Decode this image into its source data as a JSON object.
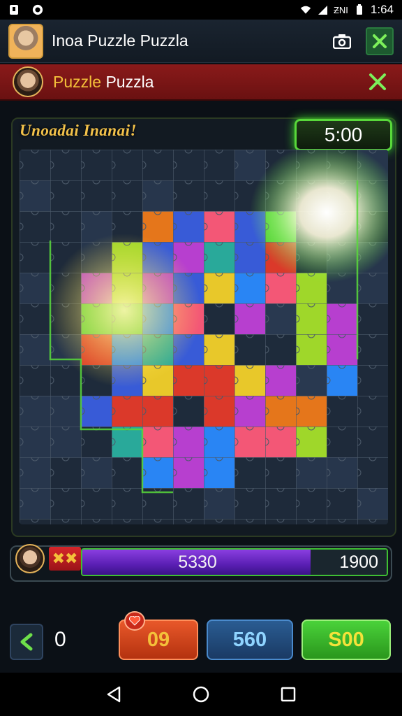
{
  "status_bar": {
    "time": "1:64",
    "network_text": "ƵNI",
    "icons": [
      "notification-icon",
      "app-icon",
      "wifi-icon",
      "signal-icon",
      "battery-icon"
    ]
  },
  "app_bar": {
    "title": "Inoa Puzzle Puzzla",
    "icons": [
      "camera-icon",
      "close-icon"
    ]
  },
  "banner": {
    "title_part1": "Puzzle",
    "title_part2": "Puzzla",
    "title_color": "#f4c03a"
  },
  "board": {
    "label": "Unoadai Inanai!",
    "timer": "5:00"
  },
  "score": {
    "flag_text": "✖✖",
    "current": "5330",
    "target": "1900",
    "progress_fraction": 0.75
  },
  "controls": {
    "moves": "0",
    "orange_button": "09",
    "blue_button": "560",
    "green_button": "S00"
  },
  "colors": {
    "accent_green": "#58d83a",
    "banner_red": "#8a1a1a",
    "orange": "#e8582a",
    "blue": "#2a5c92"
  }
}
